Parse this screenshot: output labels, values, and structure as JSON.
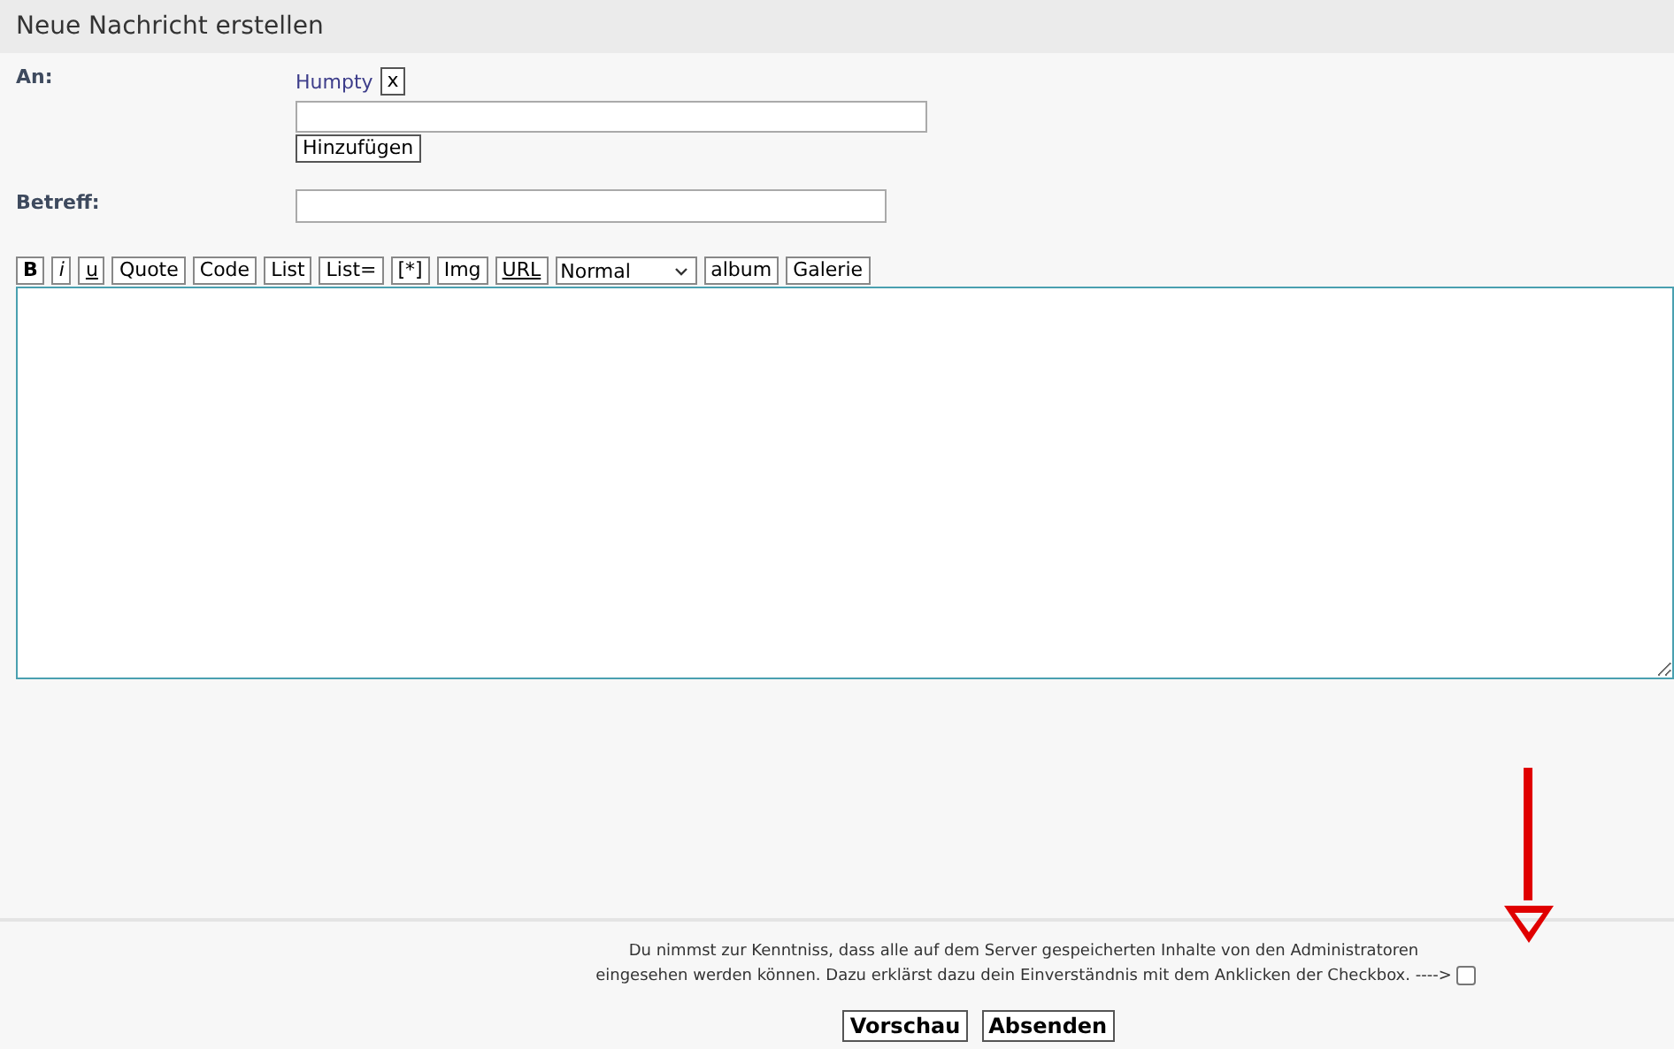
{
  "header": {
    "title": "Neue Nachricht erstellen"
  },
  "recipients": {
    "label": "An:",
    "items": [
      {
        "name": "Humpty",
        "remove": "x"
      }
    ],
    "add_button": "Hinzufügen"
  },
  "subject": {
    "label": "Betreff:"
  },
  "toolbar": [
    {
      "label": "B",
      "kind": "bold"
    },
    {
      "label": "i",
      "kind": "italic"
    },
    {
      "label": "u",
      "kind": "underline"
    },
    {
      "label": "Quote",
      "kind": "plain"
    },
    {
      "label": "Code",
      "kind": "plain"
    },
    {
      "label": "List",
      "kind": "plain"
    },
    {
      "label": "List=",
      "kind": "plain"
    },
    {
      "label": "[*]",
      "kind": "plain"
    },
    {
      "label": "Img",
      "kind": "plain"
    },
    {
      "label": "URL",
      "kind": "underline"
    },
    {
      "label": "Normal",
      "kind": "select"
    },
    {
      "label": "album",
      "kind": "plain"
    },
    {
      "label": "Galerie",
      "kind": "plain"
    }
  ],
  "footer": {
    "notice_lines": [
      "Du nimmst zur Kenntniss, dass alle auf dem Server gespeicherten Inhalte von den Administratoren",
      "eingesehen werden können. Dazu erklärst dazu dein Einverständnis mit dem Anklicken der Checkbox. ---->"
    ],
    "consent": {
      "checked": false
    },
    "buttons": [
      "Vorschau",
      "Absenden"
    ]
  }
}
